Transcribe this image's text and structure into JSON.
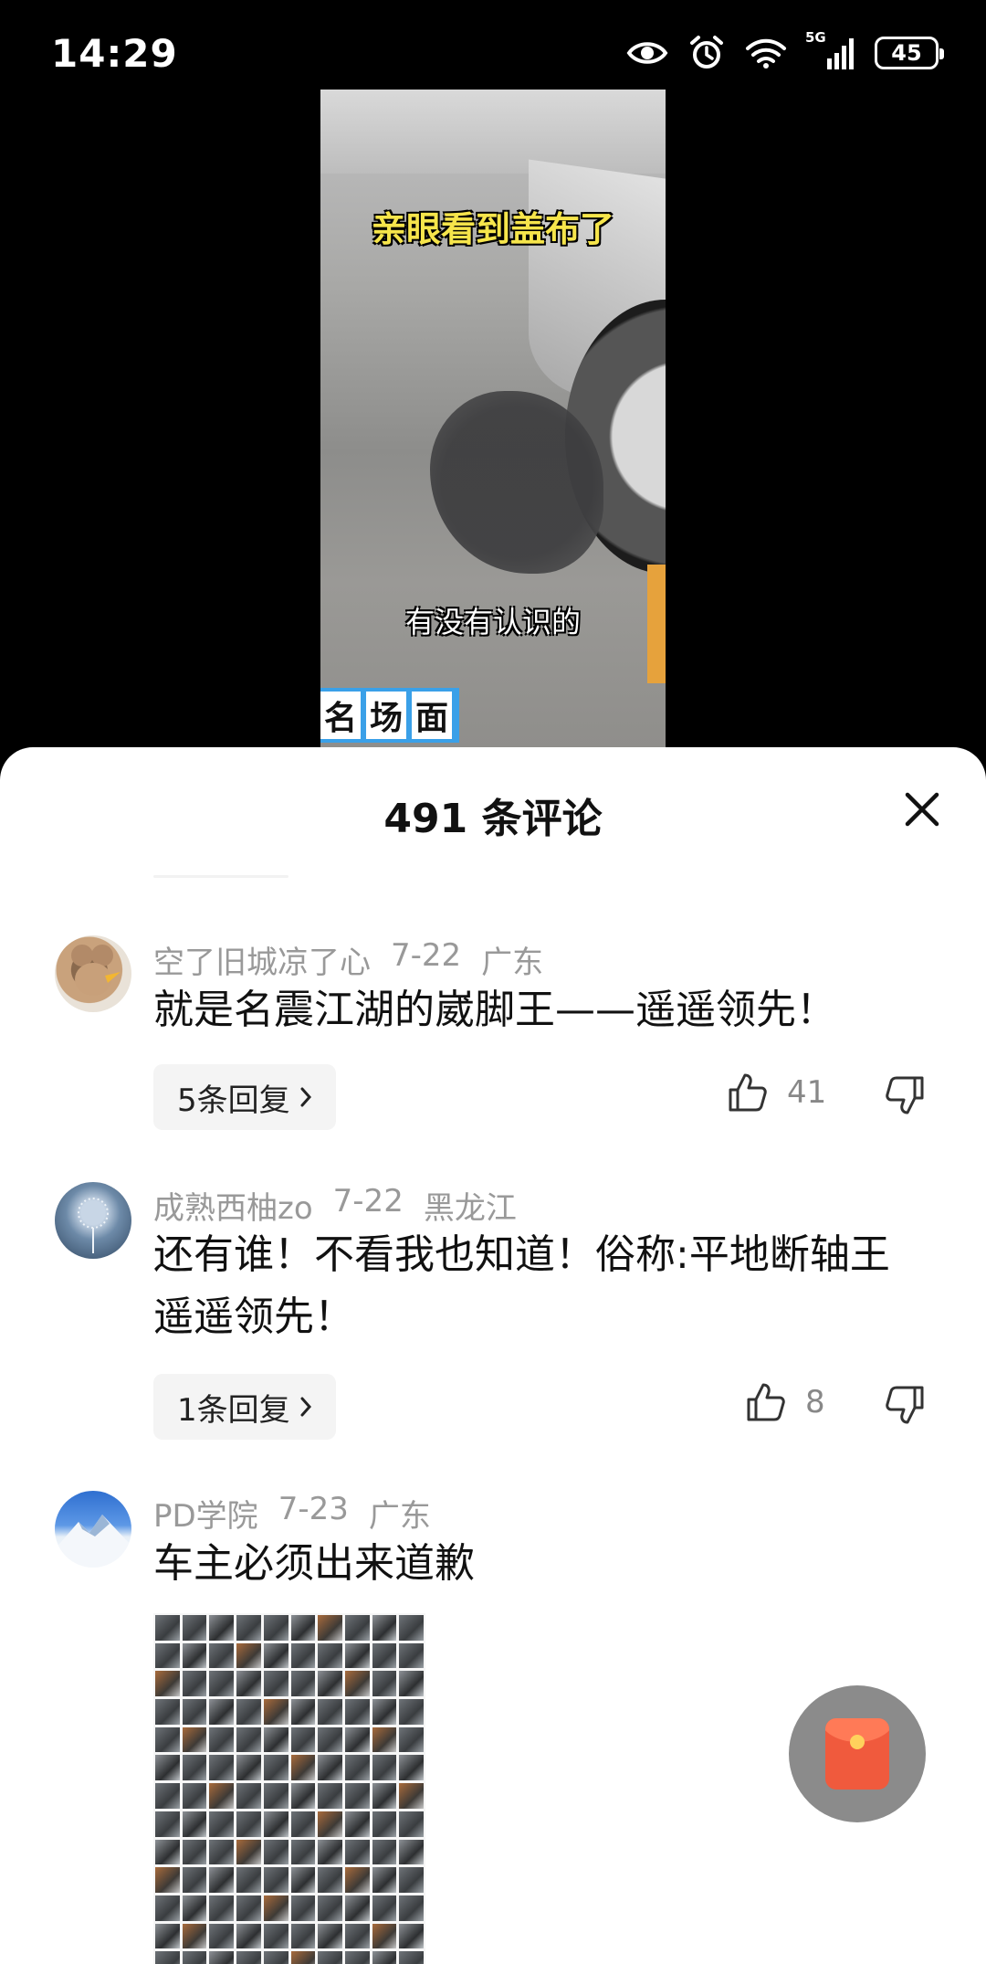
{
  "status_bar": {
    "time": "14:29",
    "network": "5G",
    "battery": "45",
    "icons": [
      "eye-icon",
      "alarm-icon",
      "wifi-icon",
      "signal-icon",
      "battery-icon"
    ]
  },
  "video": {
    "caption_top": "亲眼看到盖布了",
    "caption_bottom": "有没有认识的",
    "badge_chars": [
      "名",
      "场",
      "面"
    ]
  },
  "comments_sheet": {
    "title": "491 条评论",
    "close_icon": "close-icon",
    "comments": [
      {
        "author": "空了旧城凉了心",
        "date": "7-22",
        "location": "广东",
        "text": "就是名震江湖的崴脚王——遥遥领先！",
        "replies": "5条回复",
        "likes": "41"
      },
      {
        "author": "成熟西柚zo",
        "date": "7-22",
        "location": "黑龙江",
        "text": "还有谁！不看我也知道！俗称:平地断轴王遥遥领先！",
        "replies": "1条回复",
        "likes": "8"
      },
      {
        "author": "PD学院",
        "date": "7-23",
        "location": "广东",
        "text": "车主必须出来道歉"
      }
    ]
  },
  "floating": {
    "red_packet_icon": "red-packet-icon"
  },
  "colors": {
    "sheet_bg": "#ffffff",
    "meta_text": "#999999",
    "body_text": "#111111",
    "reply_bg": "#f4f4f4",
    "red_packet": "#f05a3d"
  }
}
